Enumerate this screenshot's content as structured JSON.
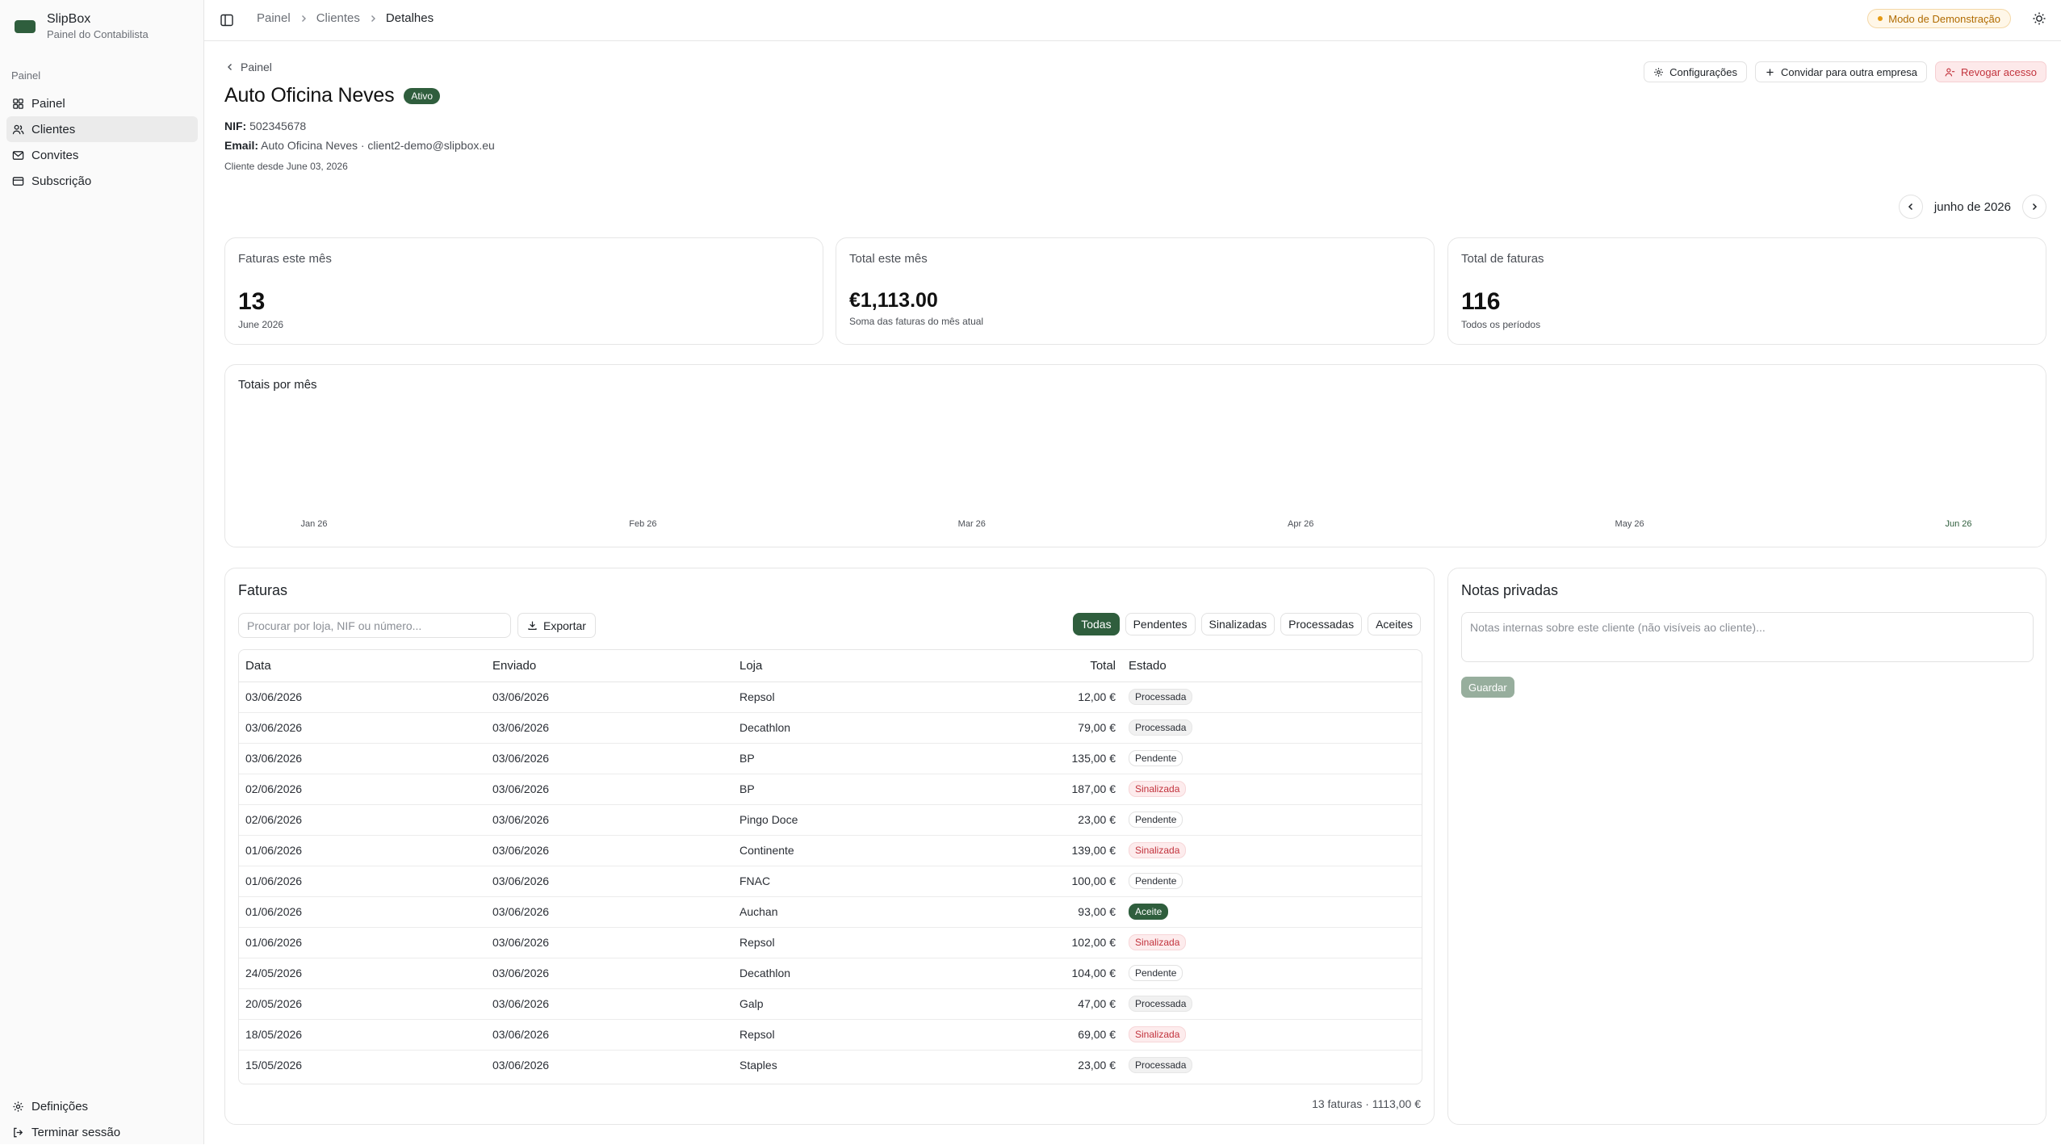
{
  "app": {
    "name": "SlipBox",
    "subtitle": "Painel do Contabilista"
  },
  "sidebar": {
    "section_label": "Painel",
    "items": [
      {
        "label": "Painel",
        "icon": "grid-icon"
      },
      {
        "label": "Clientes",
        "icon": "users-icon"
      },
      {
        "label": "Convites",
        "icon": "mail-icon"
      },
      {
        "label": "Subscrição",
        "icon": "card-icon"
      }
    ],
    "bottom": [
      {
        "label": "Definições",
        "icon": "gear-icon"
      },
      {
        "label": "Terminar sessão",
        "icon": "logout-icon"
      }
    ]
  },
  "topbar": {
    "breadcrumbs": [
      "Painel",
      "Clientes",
      "Detalhes"
    ],
    "demo_badge": "Modo de Demonstração"
  },
  "client": {
    "back_label": "Painel",
    "name": "Auto Oficina Neves",
    "status": "Ativo",
    "nif_label": "NIF:",
    "nif": "502345678",
    "email_label": "Email:",
    "email": "Auto Oficina Neves · client2-demo@slipbox.eu",
    "since": "Cliente desde June 03, 2026"
  },
  "actions": {
    "settings": "Configurações",
    "invite": "Convidar para outra empresa",
    "revoke": "Revogar acesso"
  },
  "month_nav": {
    "label": "junho de 2026"
  },
  "stats": [
    {
      "label": "Faturas este mês",
      "value": "13",
      "sub": "June 2026"
    },
    {
      "label": "Total este mês",
      "value": "€1,113.00",
      "sub": "Soma das faturas do mês atual"
    },
    {
      "label": "Total de faturas",
      "value": "116",
      "sub": "Todos os períodos"
    }
  ],
  "chart_data": {
    "type": "bar",
    "title": "Totais por mês",
    "categories": [
      "Jan 26",
      "Feb 26",
      "Mar 26",
      "Apr 26",
      "May 26",
      "Jun 26"
    ],
    "values": [
      0,
      0,
      0,
      0,
      0,
      0
    ],
    "highlight_category": "Jun 26",
    "highlight_color": "#2f5e3d",
    "grid": false
  },
  "invoices": {
    "title": "Faturas",
    "search_placeholder": "Procurar por loja, NIF ou número...",
    "export_label": "Exportar",
    "filters": [
      "Todas",
      "Pendentes",
      "Sinalizadas",
      "Processadas",
      "Aceites"
    ],
    "active_filter": "Todas",
    "columns": [
      "Data",
      "Enviado",
      "Loja",
      "Total",
      "Estado"
    ],
    "rows": [
      {
        "data": "03/06/2026",
        "enviado": "03/06/2026",
        "loja": "Repsol",
        "total": "12,00 €",
        "estado": "Processada",
        "kind": "processada"
      },
      {
        "data": "03/06/2026",
        "enviado": "03/06/2026",
        "loja": "Decathlon",
        "total": "79,00 €",
        "estado": "Processada",
        "kind": "processada"
      },
      {
        "data": "03/06/2026",
        "enviado": "03/06/2026",
        "loja": "BP",
        "total": "135,00 €",
        "estado": "Pendente",
        "kind": "pendente"
      },
      {
        "data": "02/06/2026",
        "enviado": "03/06/2026",
        "loja": "BP",
        "total": "187,00 €",
        "estado": "Sinalizada",
        "kind": "sinalizada"
      },
      {
        "data": "02/06/2026",
        "enviado": "03/06/2026",
        "loja": "Pingo Doce",
        "total": "23,00 €",
        "estado": "Pendente",
        "kind": "pendente"
      },
      {
        "data": "01/06/2026",
        "enviado": "03/06/2026",
        "loja": "Continente",
        "total": "139,00 €",
        "estado": "Sinalizada",
        "kind": "sinalizada"
      },
      {
        "data": "01/06/2026",
        "enviado": "03/06/2026",
        "loja": "FNAC",
        "total": "100,00 €",
        "estado": "Pendente",
        "kind": "pendente"
      },
      {
        "data": "01/06/2026",
        "enviado": "03/06/2026",
        "loja": "Auchan",
        "total": "93,00 €",
        "estado": "Aceite",
        "kind": "aceite"
      },
      {
        "data": "01/06/2026",
        "enviado": "03/06/2026",
        "loja": "Repsol",
        "total": "102,00 €",
        "estado": "Sinalizada",
        "kind": "sinalizada"
      },
      {
        "data": "24/05/2026",
        "enviado": "03/06/2026",
        "loja": "Decathlon",
        "total": "104,00 €",
        "estado": "Pendente",
        "kind": "pendente"
      },
      {
        "data": "20/05/2026",
        "enviado": "03/06/2026",
        "loja": "Galp",
        "total": "47,00 €",
        "estado": "Processada",
        "kind": "processada"
      },
      {
        "data": "18/05/2026",
        "enviado": "03/06/2026",
        "loja": "Repsol",
        "total": "69,00 €",
        "estado": "Sinalizada",
        "kind": "sinalizada"
      },
      {
        "data": "15/05/2026",
        "enviado": "03/06/2026",
        "loja": "Staples",
        "total": "23,00 €",
        "estado": "Processada",
        "kind": "processada"
      }
    ],
    "footer": "13 faturas · 1113,00 €"
  },
  "notes": {
    "title": "Notas privadas",
    "placeholder": "Notas internas sobre este cliente (não visíveis ao cliente)...",
    "save_label": "Guardar"
  },
  "colors": {
    "accent": "#2f5e3d",
    "danger": "#c2333d",
    "warning": "#b06b00"
  }
}
